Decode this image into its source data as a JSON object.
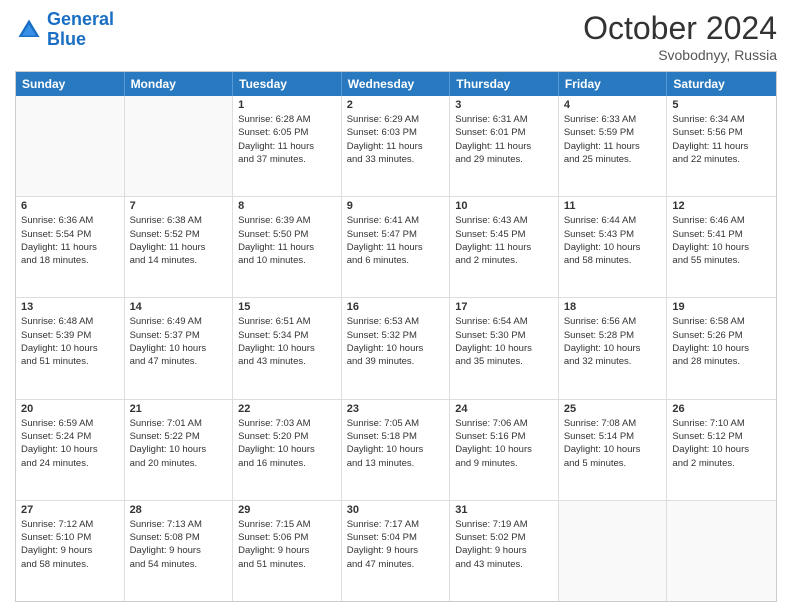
{
  "logo": {
    "line1": "General",
    "line2": "Blue"
  },
  "title": "October 2024",
  "subtitle": "Svobodnyy, Russia",
  "days_of_week": [
    "Sunday",
    "Monday",
    "Tuesday",
    "Wednesday",
    "Thursday",
    "Friday",
    "Saturday"
  ],
  "weeks": [
    [
      {
        "day": "",
        "empty": true
      },
      {
        "day": "",
        "empty": true
      },
      {
        "day": "1",
        "sunrise": "Sunrise: 6:28 AM",
        "sunset": "Sunset: 6:05 PM",
        "daylight": "Daylight: 11 hours and 37 minutes."
      },
      {
        "day": "2",
        "sunrise": "Sunrise: 6:29 AM",
        "sunset": "Sunset: 6:03 PM",
        "daylight": "Daylight: 11 hours and 33 minutes."
      },
      {
        "day": "3",
        "sunrise": "Sunrise: 6:31 AM",
        "sunset": "Sunset: 6:01 PM",
        "daylight": "Daylight: 11 hours and 29 minutes."
      },
      {
        "day": "4",
        "sunrise": "Sunrise: 6:33 AM",
        "sunset": "Sunset: 5:59 PM",
        "daylight": "Daylight: 11 hours and 25 minutes."
      },
      {
        "day": "5",
        "sunrise": "Sunrise: 6:34 AM",
        "sunset": "Sunset: 5:56 PM",
        "daylight": "Daylight: 11 hours and 22 minutes."
      }
    ],
    [
      {
        "day": "6",
        "sunrise": "Sunrise: 6:36 AM",
        "sunset": "Sunset: 5:54 PM",
        "daylight": "Daylight: 11 hours and 18 minutes."
      },
      {
        "day": "7",
        "sunrise": "Sunrise: 6:38 AM",
        "sunset": "Sunset: 5:52 PM",
        "daylight": "Daylight: 11 hours and 14 minutes."
      },
      {
        "day": "8",
        "sunrise": "Sunrise: 6:39 AM",
        "sunset": "Sunset: 5:50 PM",
        "daylight": "Daylight: 11 hours and 10 minutes."
      },
      {
        "day": "9",
        "sunrise": "Sunrise: 6:41 AM",
        "sunset": "Sunset: 5:47 PM",
        "daylight": "Daylight: 11 hours and 6 minutes."
      },
      {
        "day": "10",
        "sunrise": "Sunrise: 6:43 AM",
        "sunset": "Sunset: 5:45 PM",
        "daylight": "Daylight: 11 hours and 2 minutes."
      },
      {
        "day": "11",
        "sunrise": "Sunrise: 6:44 AM",
        "sunset": "Sunset: 5:43 PM",
        "daylight": "Daylight: 10 hours and 58 minutes."
      },
      {
        "day": "12",
        "sunrise": "Sunrise: 6:46 AM",
        "sunset": "Sunset: 5:41 PM",
        "daylight": "Daylight: 10 hours and 55 minutes."
      }
    ],
    [
      {
        "day": "13",
        "sunrise": "Sunrise: 6:48 AM",
        "sunset": "Sunset: 5:39 PM",
        "daylight": "Daylight: 10 hours and 51 minutes."
      },
      {
        "day": "14",
        "sunrise": "Sunrise: 6:49 AM",
        "sunset": "Sunset: 5:37 PM",
        "daylight": "Daylight: 10 hours and 47 minutes."
      },
      {
        "day": "15",
        "sunrise": "Sunrise: 6:51 AM",
        "sunset": "Sunset: 5:34 PM",
        "daylight": "Daylight: 10 hours and 43 minutes."
      },
      {
        "day": "16",
        "sunrise": "Sunrise: 6:53 AM",
        "sunset": "Sunset: 5:32 PM",
        "daylight": "Daylight: 10 hours and 39 minutes."
      },
      {
        "day": "17",
        "sunrise": "Sunrise: 6:54 AM",
        "sunset": "Sunset: 5:30 PM",
        "daylight": "Daylight: 10 hours and 35 minutes."
      },
      {
        "day": "18",
        "sunrise": "Sunrise: 6:56 AM",
        "sunset": "Sunset: 5:28 PM",
        "daylight": "Daylight: 10 hours and 32 minutes."
      },
      {
        "day": "19",
        "sunrise": "Sunrise: 6:58 AM",
        "sunset": "Sunset: 5:26 PM",
        "daylight": "Daylight: 10 hours and 28 minutes."
      }
    ],
    [
      {
        "day": "20",
        "sunrise": "Sunrise: 6:59 AM",
        "sunset": "Sunset: 5:24 PM",
        "daylight": "Daylight: 10 hours and 24 minutes."
      },
      {
        "day": "21",
        "sunrise": "Sunrise: 7:01 AM",
        "sunset": "Sunset: 5:22 PM",
        "daylight": "Daylight: 10 hours and 20 minutes."
      },
      {
        "day": "22",
        "sunrise": "Sunrise: 7:03 AM",
        "sunset": "Sunset: 5:20 PM",
        "daylight": "Daylight: 10 hours and 16 minutes."
      },
      {
        "day": "23",
        "sunrise": "Sunrise: 7:05 AM",
        "sunset": "Sunset: 5:18 PM",
        "daylight": "Daylight: 10 hours and 13 minutes."
      },
      {
        "day": "24",
        "sunrise": "Sunrise: 7:06 AM",
        "sunset": "Sunset: 5:16 PM",
        "daylight": "Daylight: 10 hours and 9 minutes."
      },
      {
        "day": "25",
        "sunrise": "Sunrise: 7:08 AM",
        "sunset": "Sunset: 5:14 PM",
        "daylight": "Daylight: 10 hours and 5 minutes."
      },
      {
        "day": "26",
        "sunrise": "Sunrise: 7:10 AM",
        "sunset": "Sunset: 5:12 PM",
        "daylight": "Daylight: 10 hours and 2 minutes."
      }
    ],
    [
      {
        "day": "27",
        "sunrise": "Sunrise: 7:12 AM",
        "sunset": "Sunset: 5:10 PM",
        "daylight": "Daylight: 9 hours and 58 minutes."
      },
      {
        "day": "28",
        "sunrise": "Sunrise: 7:13 AM",
        "sunset": "Sunset: 5:08 PM",
        "daylight": "Daylight: 9 hours and 54 minutes."
      },
      {
        "day": "29",
        "sunrise": "Sunrise: 7:15 AM",
        "sunset": "Sunset: 5:06 PM",
        "daylight": "Daylight: 9 hours and 51 minutes."
      },
      {
        "day": "30",
        "sunrise": "Sunrise: 7:17 AM",
        "sunset": "Sunset: 5:04 PM",
        "daylight": "Daylight: 9 hours and 47 minutes."
      },
      {
        "day": "31",
        "sunrise": "Sunrise: 7:19 AM",
        "sunset": "Sunset: 5:02 PM",
        "daylight": "Daylight: 9 hours and 43 minutes."
      },
      {
        "day": "",
        "empty": true
      },
      {
        "day": "",
        "empty": true
      }
    ]
  ]
}
